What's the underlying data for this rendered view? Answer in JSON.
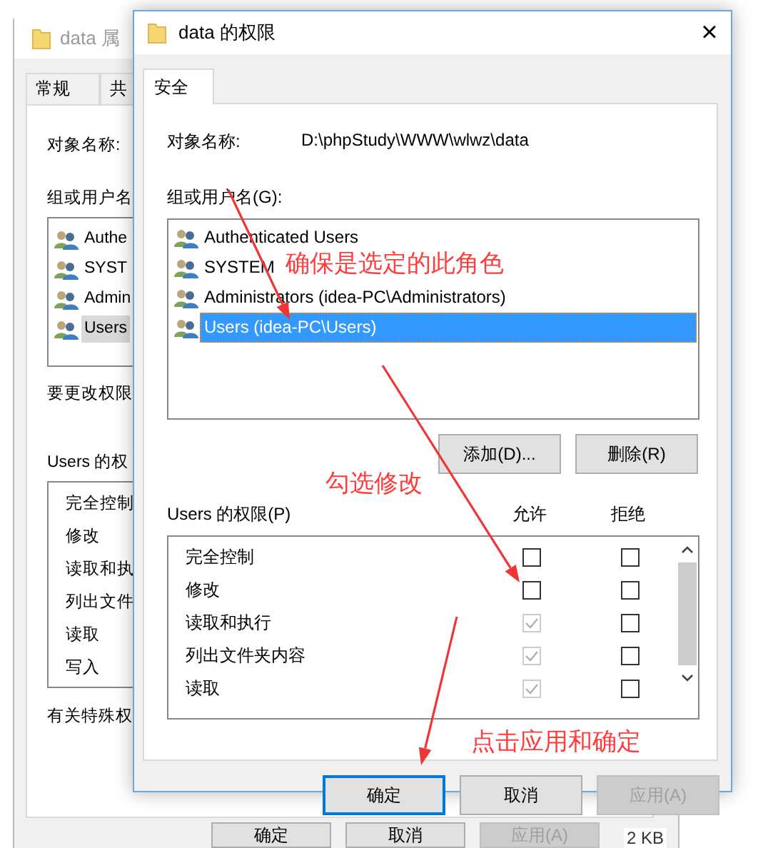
{
  "explorer_row": {
    "size": "2 KB"
  },
  "properties_window": {
    "title": "data 属",
    "tabs": [
      "常规",
      "共"
    ],
    "object_label": "对象名称:",
    "group_label": "组或用户名",
    "users": [
      {
        "name": "Authe",
        "selected": false
      },
      {
        "name": "SYST",
        "selected": false
      },
      {
        "name": "Admin",
        "selected": false
      },
      {
        "name": "Users",
        "selected": true
      }
    ],
    "change_hint": "要更改权限",
    "permissions_label": "Users 的权",
    "permissions": [
      "完全控制",
      "修改",
      "读取和执",
      "列出文件",
      "读取",
      "写入"
    ],
    "special_hint": "有关特殊权",
    "buttons": [
      {
        "label": "确定",
        "disabled": false
      },
      {
        "label": "取消",
        "disabled": false
      },
      {
        "label": "应用(A)",
        "disabled": true
      }
    ]
  },
  "dialog": {
    "title": "data 的权限",
    "close": "×",
    "tabs": [
      {
        "label": "安全",
        "selected": true
      }
    ],
    "object_label": "对象名称:",
    "object_name": "D:\\phpStudy\\WWW\\wlwz\\data",
    "group_label": "组或用户名(G):",
    "users": [
      {
        "name": "Authenticated Users",
        "selected": false
      },
      {
        "name": "SYSTEM",
        "selected": false
      },
      {
        "name": "Administrators (idea-PC\\Administrators)",
        "selected": false
      },
      {
        "name": "Users (idea-PC\\Users)",
        "selected": true
      }
    ],
    "add_button": "添加(D)...",
    "remove_button": "删除(R)",
    "permissions_label": "Users 的权限(P)",
    "allow_header": "允许",
    "deny_header": "拒绝",
    "permissions": [
      {
        "name": "完全控制",
        "allow": {
          "checked": false,
          "disabled": false
        },
        "deny": {
          "checked": false,
          "disabled": false
        }
      },
      {
        "name": "修改",
        "allow": {
          "checked": false,
          "disabled": false
        },
        "deny": {
          "checked": false,
          "disabled": false
        }
      },
      {
        "name": "读取和执行",
        "allow": {
          "checked": true,
          "disabled": true
        },
        "deny": {
          "checked": false,
          "disabled": false
        }
      },
      {
        "name": "列出文件夹内容",
        "allow": {
          "checked": true,
          "disabled": true
        },
        "deny": {
          "checked": false,
          "disabled": false
        }
      },
      {
        "name": "读取",
        "allow": {
          "checked": true,
          "disabled": true
        },
        "deny": {
          "checked": false,
          "disabled": false
        }
      }
    ],
    "buttons": [
      {
        "label": "确定",
        "default": true,
        "disabled": false
      },
      {
        "label": "取消",
        "default": false,
        "disabled": false
      },
      {
        "label": "应用(A)",
        "default": false,
        "disabled": true
      }
    ]
  },
  "annotations": [
    {
      "text": "确保是选定的此角色"
    },
    {
      "text": "勾选修改"
    },
    {
      "text": "点击应用和确定"
    }
  ]
}
